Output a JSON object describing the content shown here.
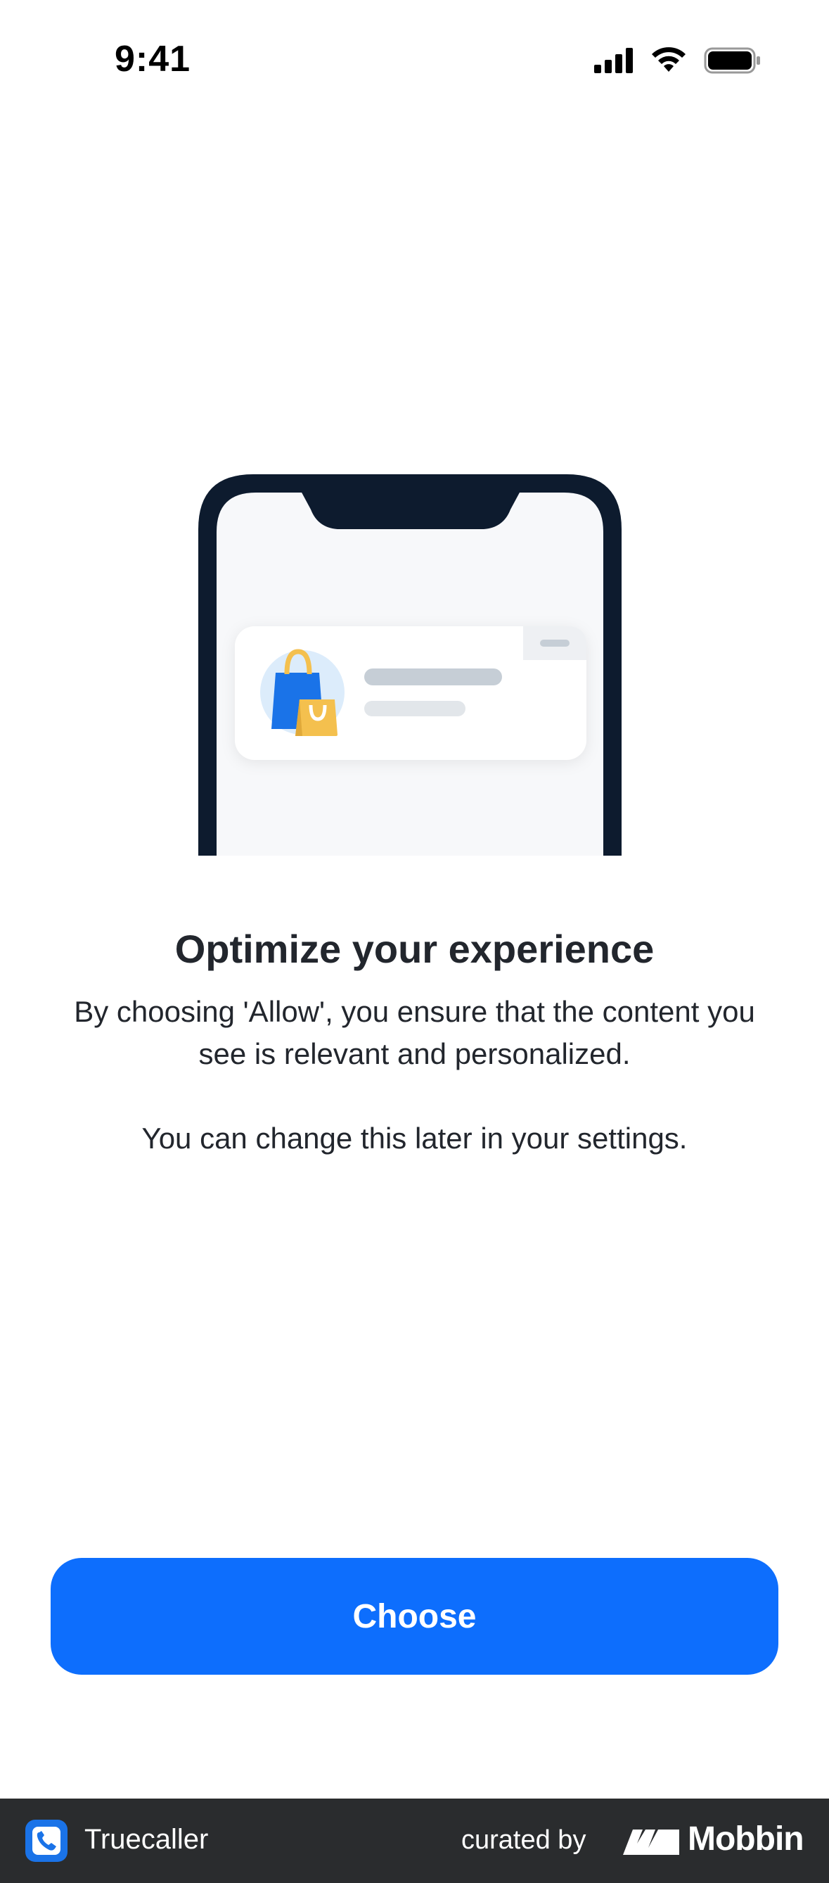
{
  "status_bar": {
    "time": "9:41",
    "icons": [
      "cellular-signal-icon",
      "wifi-icon",
      "battery-icon"
    ]
  },
  "illustration": {
    "icons": [
      "phone-frame-illustration",
      "shopping-bags-icon"
    ],
    "colors": {
      "frame": "#0d1b2e",
      "screen": "#f7f8fa",
      "card": "#ffffff",
      "avatar_bg": "#dcecfb",
      "bag_blue": "#1a73e8",
      "bag_yellow": "#f4c04e",
      "placeholder_dark": "#c6ced6",
      "placeholder_light": "#e2e6ea"
    }
  },
  "content": {
    "title": "Optimize your experience",
    "body": "By choosing 'Allow', you ensure that the content you see is relevant and personalized.",
    "note": "You can change this later in your settings."
  },
  "actions": {
    "primary_label": "Choose",
    "primary_color": "#0d6efd"
  },
  "footer": {
    "app_name": "Truecaller",
    "curated_by": "curated by",
    "brand": "Mobbin",
    "icons": [
      "truecaller-app-icon",
      "mobbin-logo-icon"
    ],
    "background": "#2a2c2e"
  }
}
